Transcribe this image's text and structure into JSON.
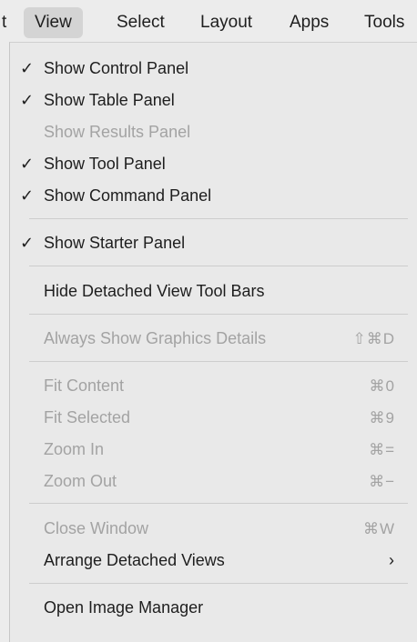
{
  "menubar": {
    "items": [
      {
        "label": "t"
      },
      {
        "label": "View"
      },
      {
        "label": "Select"
      },
      {
        "label": "Layout"
      },
      {
        "label": "Apps"
      },
      {
        "label": "Tools"
      }
    ]
  },
  "menu": {
    "items": [
      {
        "label": "Show Control Panel",
        "checked": true,
        "enabled": true,
        "check_glyph": "✓"
      },
      {
        "label": "Show Table Panel",
        "checked": true,
        "enabled": true,
        "check_glyph": "✓"
      },
      {
        "label": "Show Results Panel",
        "checked": false,
        "enabled": false
      },
      {
        "label": "Show Tool Panel",
        "checked": true,
        "enabled": true,
        "check_glyph": "✓"
      },
      {
        "label": "Show Command Panel",
        "checked": true,
        "enabled": true,
        "check_glyph": "✓"
      },
      {
        "label": "Show Starter Panel",
        "checked": true,
        "enabled": true,
        "check_glyph": "✓"
      },
      {
        "label": "Hide Detached View Tool Bars",
        "enabled": true
      },
      {
        "label": "Always Show Graphics Details",
        "enabled": false,
        "shortcut": "⇧⌘D"
      },
      {
        "label": "Fit Content",
        "enabled": false,
        "shortcut": "⌘0"
      },
      {
        "label": "Fit Selected",
        "enabled": false,
        "shortcut": "⌘9"
      },
      {
        "label": "Zoom In",
        "enabled": false,
        "shortcut": "⌘="
      },
      {
        "label": "Zoom Out",
        "enabled": false,
        "shortcut": "⌘−"
      },
      {
        "label": "Close Window",
        "enabled": false,
        "shortcut": "⌘W"
      },
      {
        "label": "Arrange Detached Views",
        "enabled": true,
        "submenu_glyph": "›"
      },
      {
        "label": "Open Image Manager",
        "enabled": true
      }
    ]
  },
  "colors": {
    "text": "#1e1e1e",
    "disabled_text": "#a3a3a3",
    "menu_background": "#e9e9e9",
    "active_menubar_item": "#d4d4d4"
  }
}
